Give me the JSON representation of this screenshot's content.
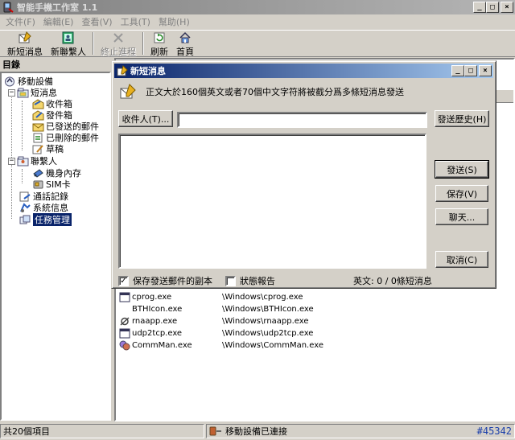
{
  "window": {
    "title": "智能手機工作室 1.1"
  },
  "menu": [
    "文件(F)",
    "編輯(E)",
    "查看(V)",
    "工具(T)",
    "幫助(H)"
  ],
  "toolbar": [
    {
      "label": "新短消息",
      "icon": "new-sms-icon",
      "enabled": true
    },
    {
      "label": "新聯繫人",
      "icon": "new-contact-icon",
      "enabled": true
    },
    {
      "label": "終止進程",
      "icon": "terminate-process-icon",
      "enabled": false
    },
    {
      "label": "刷新",
      "icon": "refresh-icon",
      "enabled": true
    },
    {
      "label": "首頁",
      "icon": "home-icon",
      "enabled": true
    }
  ],
  "left_pane": {
    "header": "目錄",
    "tree": {
      "root": "移動設備",
      "sms": "短消息",
      "inbox": "收件箱",
      "outbox": "發件箱",
      "sent": "已發送的郵件",
      "deleted": "已刪除的郵件",
      "drafts": "草稿",
      "contacts": "聯繫人",
      "phone_memory": "機身內存",
      "sim": "SIM卡",
      "call_log": "通話記錄",
      "system_info": "系統信息",
      "task_manager": "任務管理"
    }
  },
  "processes": [
    {
      "name": "cprog.exe",
      "path": "\\Windows\\cprog.exe"
    },
    {
      "name": "BTHIcon.exe",
      "path": "\\Windows\\BTHIcon.exe"
    },
    {
      "name": "rnaapp.exe",
      "path": "\\Windows\\rnaapp.exe"
    },
    {
      "name": "udp2tcp.exe",
      "path": "\\Windows\\udp2tcp.exe"
    },
    {
      "name": "CommMan.exe",
      "path": "\\Windows\\CommMan.exe"
    }
  ],
  "status": {
    "items": "共20個項目",
    "connection": "移動設備已連接",
    "id": "#45342"
  },
  "dialog": {
    "title": "新短消息",
    "info": "正文大於160個英文或者70個中文字符將被截分爲多條短消息發送",
    "recipient_button": "收件人(T)...",
    "recipient_value": "",
    "history_button": "發送歷史(H)",
    "send_button": "發送(S)",
    "save_button": "保存(V)",
    "chat_button": "聊天...",
    "cancel_button": "取消(C)",
    "save_copy_label": "保存發送郵件的副本",
    "save_copy_checked": true,
    "status_report_label": "狀態報告",
    "status_report_checked": false,
    "counter": "英文: 0 / 0條短消息"
  },
  "colors": {
    "dialog_title_start": "#0a246a",
    "dialog_title_end": "#a6caf0",
    "inactive_title": "#808080",
    "selection": "#0a246a",
    "watermark": "#1a3eaa"
  }
}
